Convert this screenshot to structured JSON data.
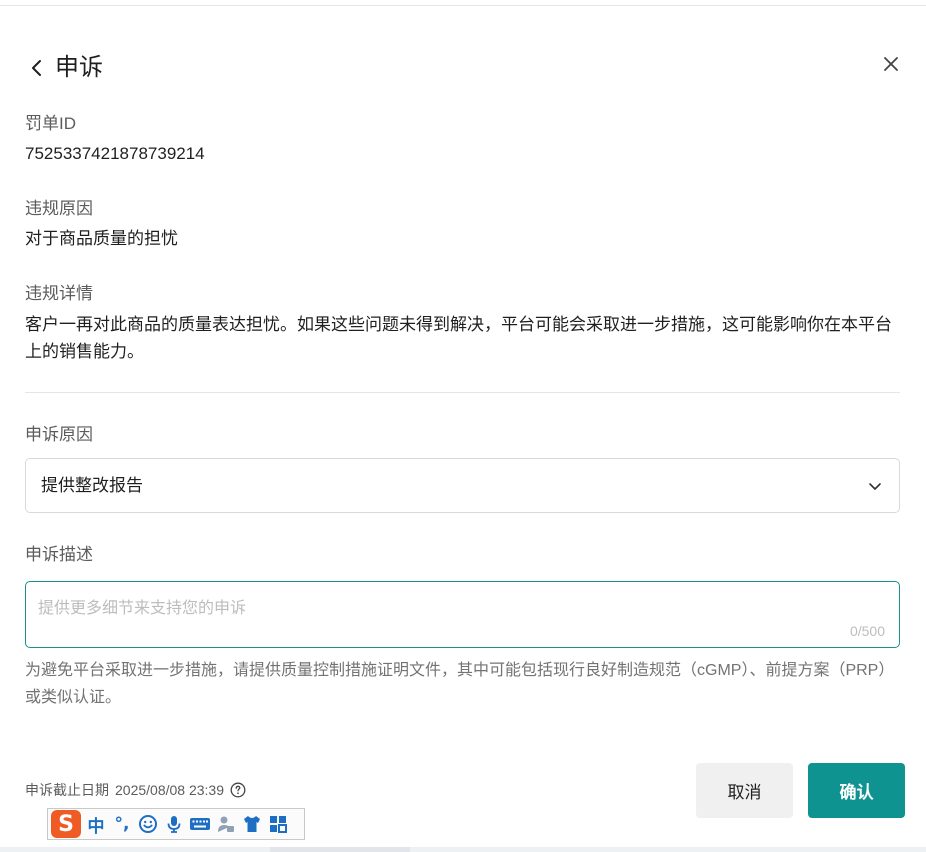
{
  "header": {
    "title": "申诉"
  },
  "penalty": {
    "id_label": "罚单ID",
    "id_value": "7525337421878739214",
    "reason_label": "违规原因",
    "reason_value": "对于商品质量的担忧",
    "detail_label": "违规详情",
    "detail_value": "客户一再对此商品的质量表达担忧。如果这些问题未得到解决，平台可能会采取进一步措施，这可能影响你在本平台上的销售能力。"
  },
  "appeal": {
    "reason_label": "申诉原因",
    "reason_selected": "提供整改报告",
    "description_label": "申诉描述",
    "description_placeholder": "提供更多细节来支持您的申诉",
    "description_value": "",
    "char_count": "0/500",
    "hint": "为避免平台采取进一步措施，请提供质量控制措施证明文件，其中可能包括现行良好制造规范（cGMP）、前提方案（PRP）或类似认证。"
  },
  "footer": {
    "deadline_label": "申诉截止日期",
    "deadline_value": "2025/08/08 23:39",
    "cancel_label": "取消",
    "confirm_label": "确认"
  },
  "ime_toolbar": {
    "logo": "S",
    "mode": "中",
    "punctuation": "°,",
    "icons": [
      "smiley-icon",
      "microphone-icon",
      "keyboard-icon",
      "user-icon",
      "shirt-icon",
      "grid-icon"
    ]
  },
  "colors": {
    "accent": "#0f9390",
    "focus_border": "#1a8f8f",
    "ime_logo": "#ef5b25",
    "ime_icon": "#1e6fc4"
  }
}
